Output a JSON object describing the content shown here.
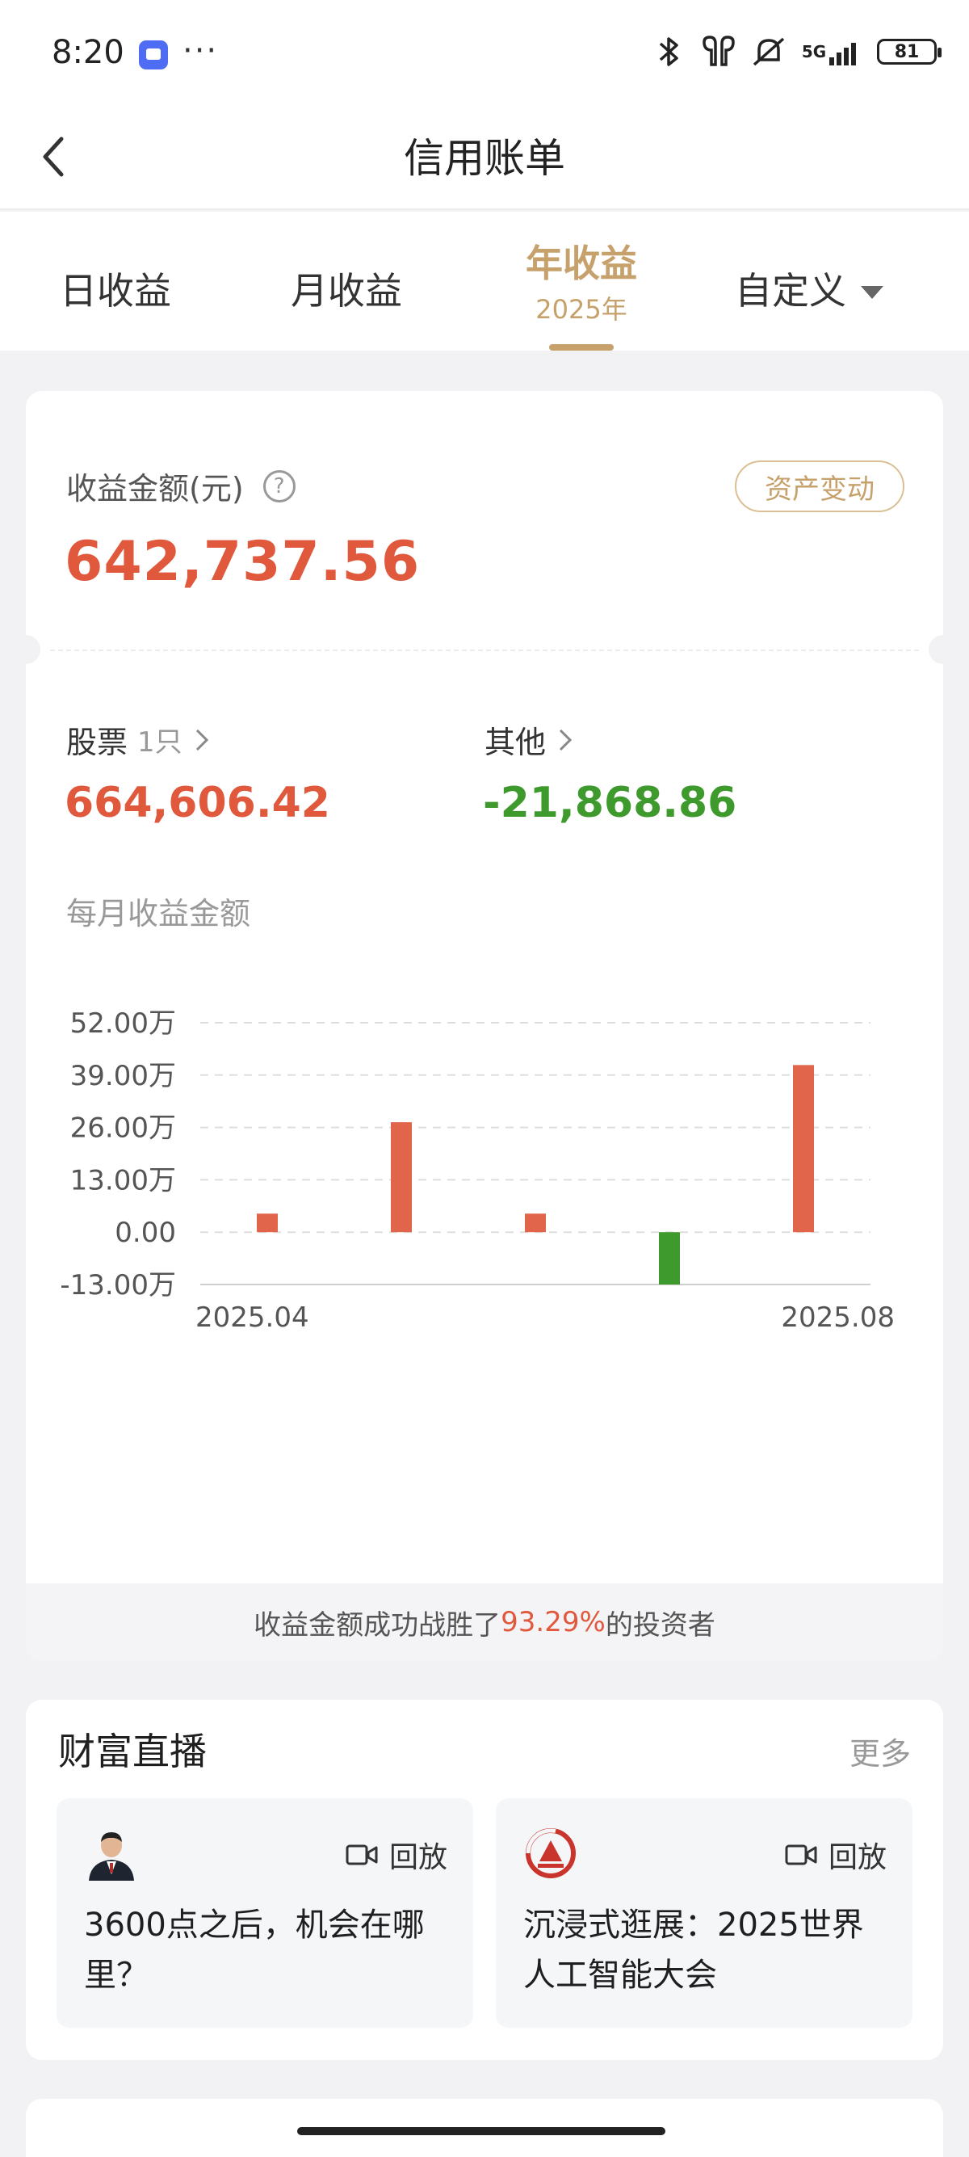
{
  "status_bar": {
    "time": "8:20",
    "more": "···",
    "network": "5G",
    "battery": "81"
  },
  "nav": {
    "title": "信用账单"
  },
  "tabs": {
    "day": "日收益",
    "month": "月收益",
    "year": "年收益",
    "year_sub": "2025年",
    "custom": "自定义"
  },
  "summary": {
    "amount_label": "收益金额(元)",
    "help": "?",
    "asset_button": "资产变动",
    "total": "642,737.56",
    "stock_label": "股票",
    "stock_count": "1只",
    "stock_value": "664,606.42",
    "other_label": "其他",
    "other_value": "-21,868.86",
    "monthly_label": "每月收益金额"
  },
  "chart_data": {
    "type": "bar",
    "title": "每月收益金额",
    "x_start_label": "2025.04",
    "x_end_label": "2025.08",
    "y_ticks": [
      "52.00万",
      "39.00万",
      "26.00万",
      "13.00万",
      "0.00",
      "-13.00万"
    ],
    "ylim": [
      -13,
      52
    ],
    "values": [
      4.6,
      27.3,
      4.6,
      -13,
      41.5
    ],
    "positive_color": "#e0654a",
    "negative_color": "#3e9a2d"
  },
  "rank": {
    "prefix": "收益金额成功战胜了",
    "percent": "93.29%",
    "suffix": "的投资者"
  },
  "live": {
    "title": "财富直播",
    "more": "更多",
    "items": [
      {
        "tag": "回放",
        "text": "3600点之后，机会在哪里？"
      },
      {
        "tag": "回放",
        "text": "沉浸式逛展：2025世界人工智能大会"
      }
    ]
  }
}
